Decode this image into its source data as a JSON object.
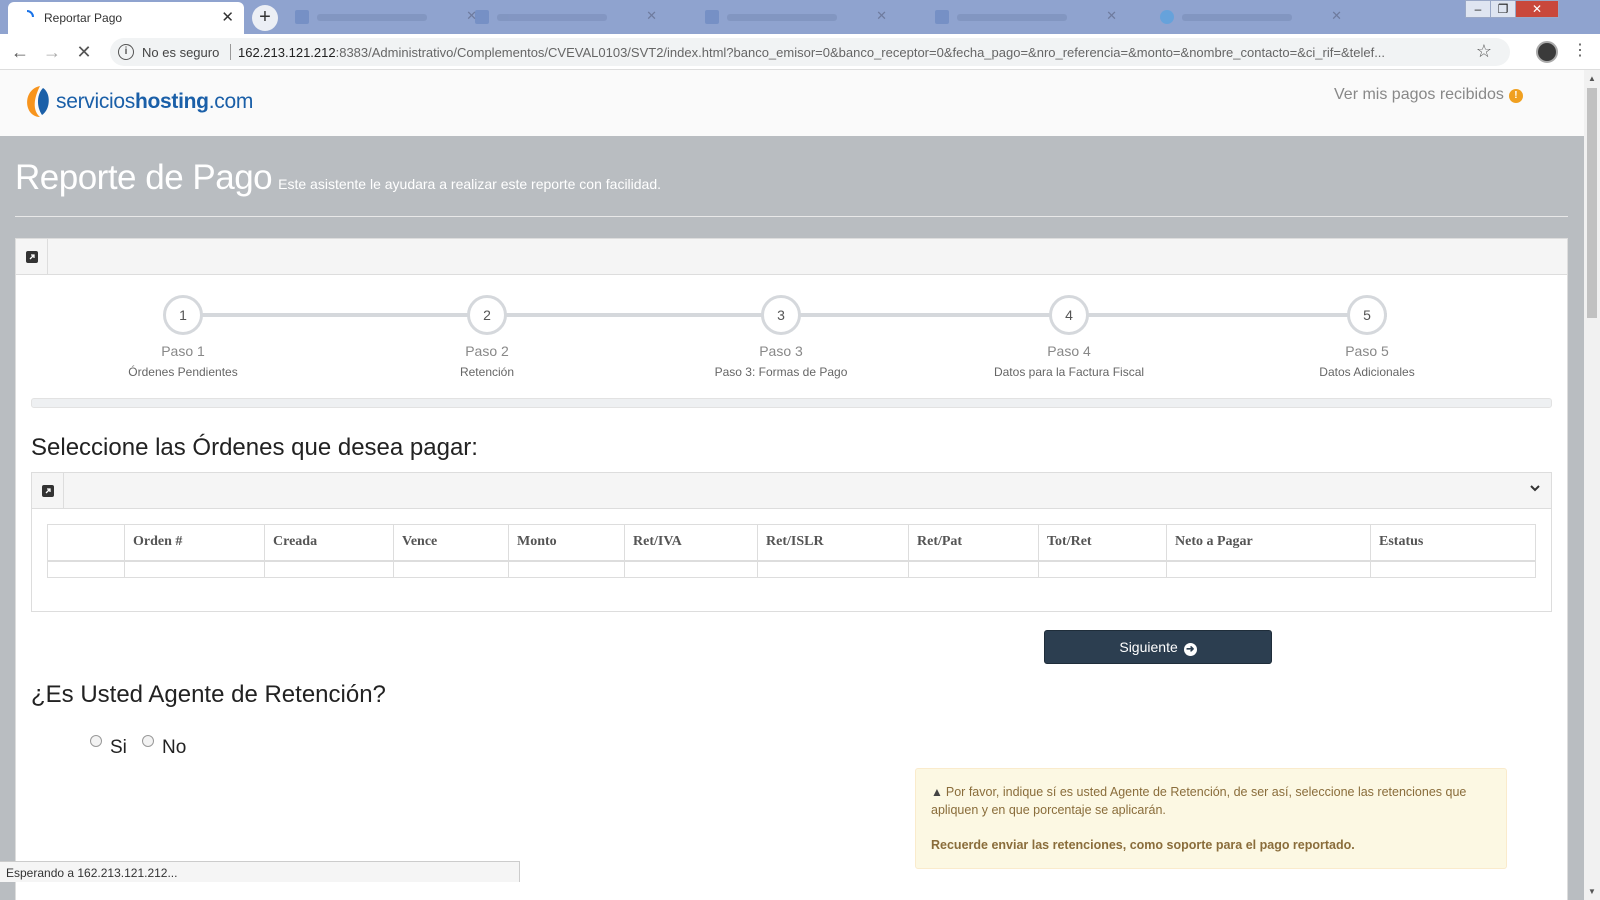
{
  "browser": {
    "tab_title": "Reportar Pago",
    "address": {
      "security_label": "No es seguro",
      "host": "162.213.121.212",
      "path": ":8383/Administrativo/Complementos/CVEVAL0103/SVT2/index.html?banco_emisor=0&banco_receptor=0&fecha_pago=&nro_referencia=&monto=&nombre_contacto=&ci_rif=&telef..."
    },
    "status_text": "Esperando a 162.213.121.212..."
  },
  "header": {
    "logo_prefix": "servicios",
    "logo_bold": "hosting",
    "logo_suffix": ".com",
    "ver_pagos": "Ver mis pagos recibidos",
    "badge": "!"
  },
  "page": {
    "title": "Reporte de Pago",
    "subtitle": "Este asistente le ayudara a realizar este reporte con facilidad."
  },
  "steps": [
    {
      "num": "1",
      "name": "Paso 1",
      "desc": "Órdenes Pendientes"
    },
    {
      "num": "2",
      "name": "Paso 2",
      "desc": "Retención"
    },
    {
      "num": "3",
      "name": "Paso 3",
      "desc": "Paso 3: Formas de Pago"
    },
    {
      "num": "4",
      "name": "Paso 4",
      "desc": "Datos para la Factura Fiscal"
    },
    {
      "num": "5",
      "name": "Paso 5",
      "desc": "Datos Adicionales"
    }
  ],
  "orders": {
    "heading": "Seleccione las Órdenes que desea pagar:",
    "columns": [
      "",
      "Orden #",
      "Creada",
      "Vence",
      "Monto",
      "Ret/IVA",
      "Ret/ISLR",
      "Ret/Pat",
      "Tot/Ret",
      "Neto a Pagar",
      "Estatus"
    ]
  },
  "next_button": "Siguiente",
  "retention": {
    "heading": "¿Es Usted Agente de Retención?",
    "yes": "Si",
    "no": "No"
  },
  "alert": {
    "text": "Por favor, indique sí es usted Agente de Retención, de ser así, seleccione las retenciones que apliquen y en que porcentaje se aplicarán.",
    "bold": "Recuerde enviar las retenciones, como soporte para el pago reportado."
  },
  "colors": {
    "brand_blue": "#1a5fa8",
    "brand_orange": "#f7941d",
    "button_dark": "#2c3e50",
    "alert_bg": "#fcf8e3"
  }
}
